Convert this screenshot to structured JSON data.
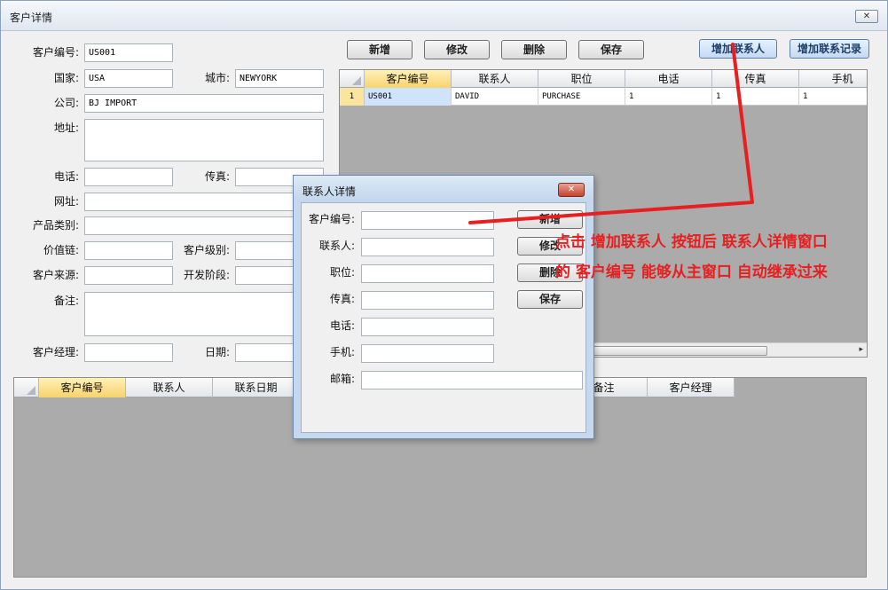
{
  "window": {
    "title": "客户详情",
    "close_glyph": "✕"
  },
  "form": {
    "customer_id_label": "客户编号:",
    "customer_id_value": "US001",
    "country_label": "国家:",
    "country_value": "USA",
    "city_label": "城市:",
    "city_value": "NEWYORK",
    "company_label": "公司:",
    "company_value": "BJ IMPORT",
    "address_label": "地址:",
    "phone_label": "电话:",
    "fax_label": "传真:",
    "website_label": "网址:",
    "category_label": "产品类别:",
    "value_chain_label": "价值链:",
    "customer_level_label": "客户级别:",
    "source_label": "客户来源:",
    "dev_stage_label": "开发阶段:",
    "notes_label": "备注:",
    "manager_label": "客户经理:",
    "date_label": "日期:"
  },
  "toolbar": {
    "add": "新增",
    "edit": "修改",
    "delete": "删除",
    "save": "保存",
    "add_contact": "增加联系人",
    "add_contact_record": "增加联系记录"
  },
  "contacts_grid": {
    "headers": [
      "客户编号",
      "联系人",
      "职位",
      "电话",
      "传真",
      "手机"
    ],
    "rows": [
      {
        "num": "1",
        "cells": [
          "US001",
          "DAVID",
          "PURCHASE",
          "1",
          "1",
          "1"
        ]
      }
    ]
  },
  "records_grid": {
    "headers": [
      "客户编号",
      "联系人",
      "联系日期",
      "",
      "",
      "",
      "备注",
      "客户经理"
    ]
  },
  "dialog": {
    "title": "联系人详情",
    "close_glyph": "✕",
    "labels": [
      "客户编号:",
      "联系人:",
      "职位:",
      "传真:",
      "电话:",
      "手机:",
      "邮箱:"
    ],
    "buttons": {
      "add": "新增",
      "edit": "修改",
      "delete": "删除",
      "save": "保存"
    }
  },
  "annotation": {
    "line1": "点击 增加联系人 按钮后 联系人详情窗口",
    "line2": "的 客户编号 能够从主窗口 自动继承过来",
    "color": "#e62020"
  }
}
